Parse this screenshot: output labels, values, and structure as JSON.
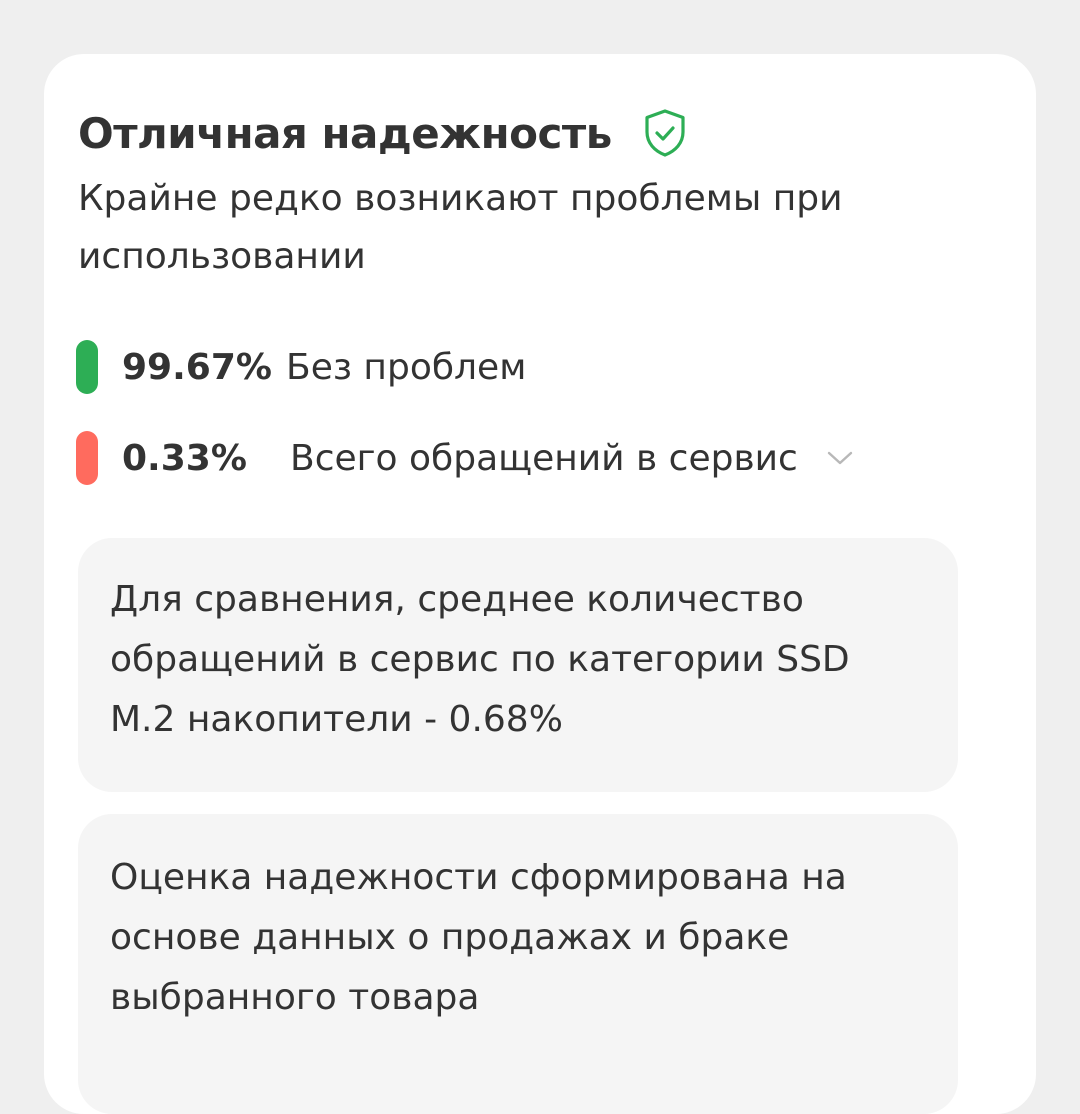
{
  "reliability": {
    "title": "Отличная надежность",
    "subtitle": "Крайне редко возникают проблемы при использовании",
    "stats": [
      {
        "percent": "99.67%",
        "label": "Без проблем",
        "color": "#2dae55"
      },
      {
        "percent": "0.33%",
        "label": "Всего обращений в сервис",
        "color": "#ff6b5e"
      }
    ],
    "comparison_note": "Для сравнения, среднее количество обращений в сервис по категории SSD M.2 накопители - 0.68%",
    "method_note": "Оценка надежности сформирована на основе данных о продажах и браке выбранного товара"
  },
  "icons": {
    "badge": "shield-check-icon",
    "expand": "chevron-down-icon"
  },
  "colors": {
    "accent_green": "#2dae55",
    "accent_red": "#ff6b5e",
    "card_background": "#ffffff",
    "page_background": "#efefef",
    "note_background": "#f5f5f5"
  }
}
